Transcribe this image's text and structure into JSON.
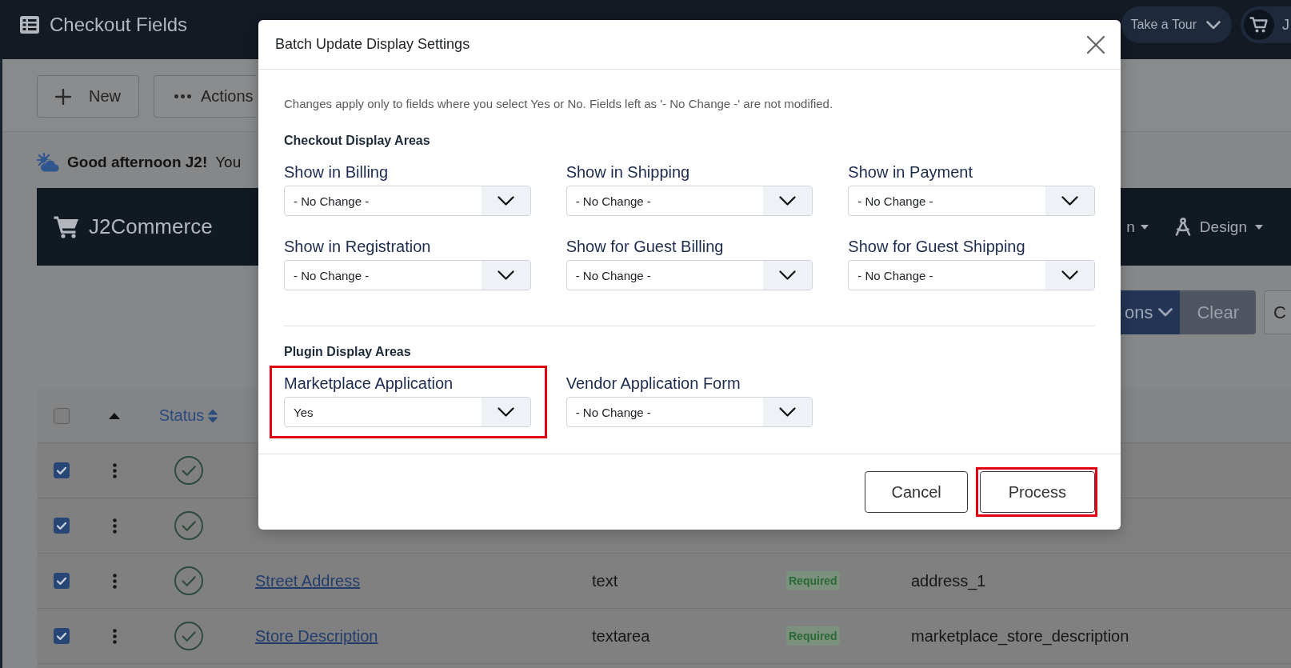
{
  "app_bar": {
    "title": "Checkout Fields",
    "tour_button": "Take a Tour",
    "user_menu": "J"
  },
  "toolbar": [
    {
      "label": "New",
      "kind": "new"
    },
    {
      "label": "Actions",
      "kind": "more"
    }
  ],
  "greeting": "**Good afternoon J2!** You",
  "banner": {
    "brand": "J2Commerce",
    "menus": [
      {
        "label": "n",
        "kind": "plain"
      },
      {
        "label": "Design",
        "kind": "design"
      }
    ]
  },
  "filter_bar": [
    {
      "label": "ons",
      "kind": "primary"
    },
    {
      "label": "Clear",
      "kind": "secondary"
    },
    {
      "label": "C",
      "kind": "outline"
    }
  ],
  "table": {
    "select_all": {
      "checked": false
    },
    "columns": [
      {
        "label": "Status",
        "sortable": true
      }
    ],
    "rows": [
      {
        "checked": true,
        "published": true
      },
      {
        "checked": true,
        "published": true
      },
      {
        "checked": true,
        "published": true,
        "name": "Street Address",
        "type": "text",
        "required": "Required",
        "key": "address_1"
      },
      {
        "checked": true,
        "published": true,
        "name": "Store Description",
        "type": "textarea",
        "required": "Required",
        "key": "marketplace_store_description"
      }
    ]
  },
  "modal": {
    "title": "Batch Update Display Settings",
    "intro": "Changes apply only to fields where you select Yes or No. Fields left as '- No Change -' are not modified.",
    "sections": [
      {
        "heading": "Checkout Display Areas",
        "fields": [
          {
            "label": "Show in Billing",
            "value": "- No Change -",
            "highlighted": false
          },
          {
            "label": "Show in Shipping",
            "value": "- No Change -",
            "highlighted": false
          },
          {
            "label": "Show in Payment",
            "value": "- No Change -",
            "highlighted": false
          },
          {
            "label": "Show in Registration",
            "value": "- No Change -",
            "highlighted": false
          },
          {
            "label": "Show for Guest Billing",
            "value": "- No Change -",
            "highlighted": false
          },
          {
            "label": "Show for Guest Shipping",
            "value": "- No Change -",
            "highlighted": false
          }
        ]
      },
      {
        "heading": "Plugin Display Areas",
        "fields": [
          {
            "label": "Marketplace Application",
            "value": "Yes",
            "highlighted": true
          },
          {
            "label": "Vendor Application Form",
            "value": "- No Change -",
            "highlighted": false
          }
        ]
      }
    ],
    "buttons": [
      {
        "label": "Cancel",
        "kind": "cancel",
        "highlighted": false
      },
      {
        "label": "Process",
        "kind": "process",
        "highlighted": true
      }
    ]
  }
}
